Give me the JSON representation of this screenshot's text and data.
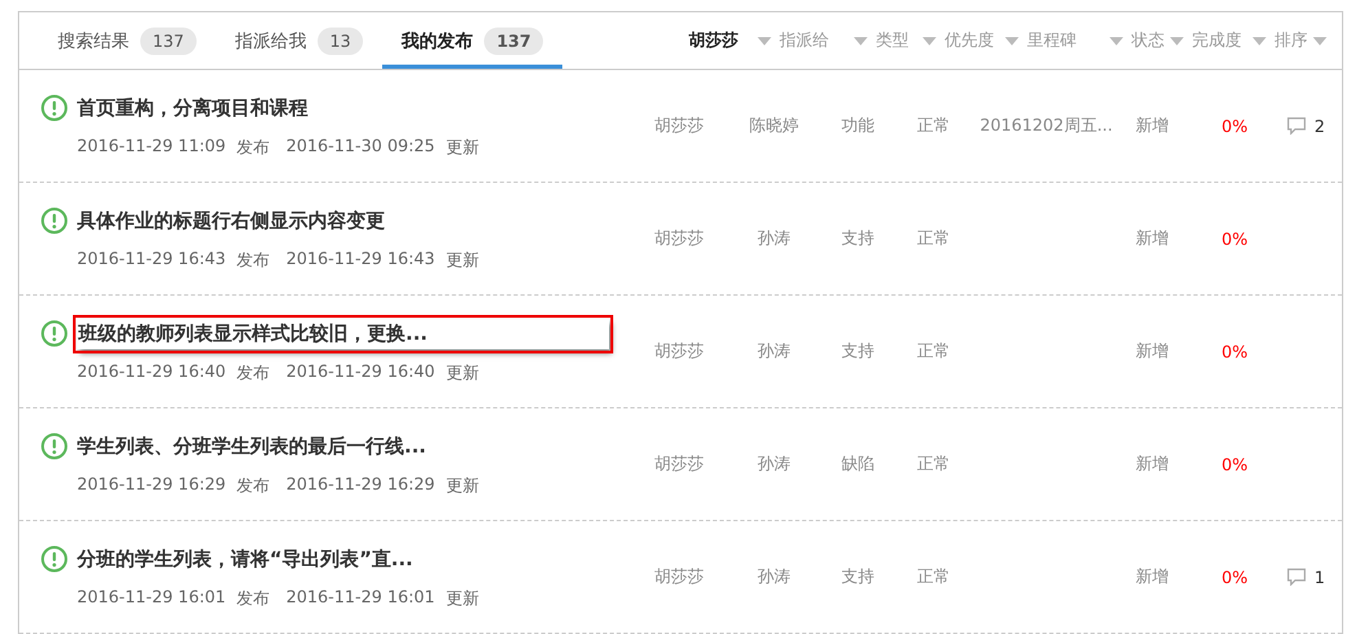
{
  "tabs": [
    {
      "label": "搜索结果",
      "count": "137",
      "selected": false
    },
    {
      "label": "指派给我",
      "count": "13",
      "selected": false
    },
    {
      "label": "我的发布",
      "count": "137",
      "selected": true
    }
  ],
  "filters": [
    {
      "label": "胡莎莎",
      "selected": true
    },
    {
      "label": "指派给",
      "selected": false
    },
    {
      "label": "类型",
      "selected": false
    },
    {
      "label": "优先度",
      "selected": false
    },
    {
      "label": "里程碑",
      "selected": false
    },
    {
      "label": "状态",
      "selected": false
    },
    {
      "label": "完成度",
      "selected": false
    },
    {
      "label": "排序",
      "selected": false
    }
  ],
  "rows": [
    {
      "title": "首页重构，分离项目和课程",
      "highlighted": false,
      "created": "2016-11-29 11:09",
      "created_label": "发布",
      "updated": "2016-11-30 09:25",
      "updated_label": "更新",
      "reporter": "胡莎莎",
      "assignee": "陈晓婷",
      "type": "功能",
      "priority": "正常",
      "milestone": "20161202周五...",
      "status": "新增",
      "completion": "0%",
      "comments": "2"
    },
    {
      "title": "具体作业的标题行右侧显示内容变更",
      "highlighted": false,
      "created": "2016-11-29 16:43",
      "created_label": "发布",
      "updated": "2016-11-29 16:43",
      "updated_label": "更新",
      "reporter": "胡莎莎",
      "assignee": "孙涛",
      "type": "支持",
      "priority": "正常",
      "status": "新增",
      "completion": "0%"
    },
    {
      "title": "班级的教师列表显示样式比较旧，更换...",
      "highlighted": true,
      "created": "2016-11-29 16:40",
      "created_label": "发布",
      "updated": "2016-11-29 16:40",
      "updated_label": "更新",
      "reporter": "胡莎莎",
      "assignee": "孙涛",
      "type": "支持",
      "priority": "正常",
      "status": "新增",
      "completion": "0%"
    },
    {
      "title": "学生列表、分班学生列表的最后一行线...",
      "highlighted": false,
      "created": "2016-11-29 16:29",
      "created_label": "发布",
      "updated": "2016-11-29 16:29",
      "updated_label": "更新",
      "reporter": "胡莎莎",
      "assignee": "孙涛",
      "type": "缺陷",
      "priority": "正常",
      "status": "新增",
      "completion": "0%"
    },
    {
      "title": "分班的学生列表，请将“导出列表”直...",
      "highlighted": false,
      "created": "2016-11-29 16:01",
      "created_label": "发布",
      "updated": "2016-11-29 16:01",
      "updated_label": "更新",
      "reporter": "胡莎莎",
      "assignee": "孙涛",
      "type": "支持",
      "priority": "正常",
      "status": "新增",
      "completion": "0%",
      "comments": "1"
    }
  ]
}
